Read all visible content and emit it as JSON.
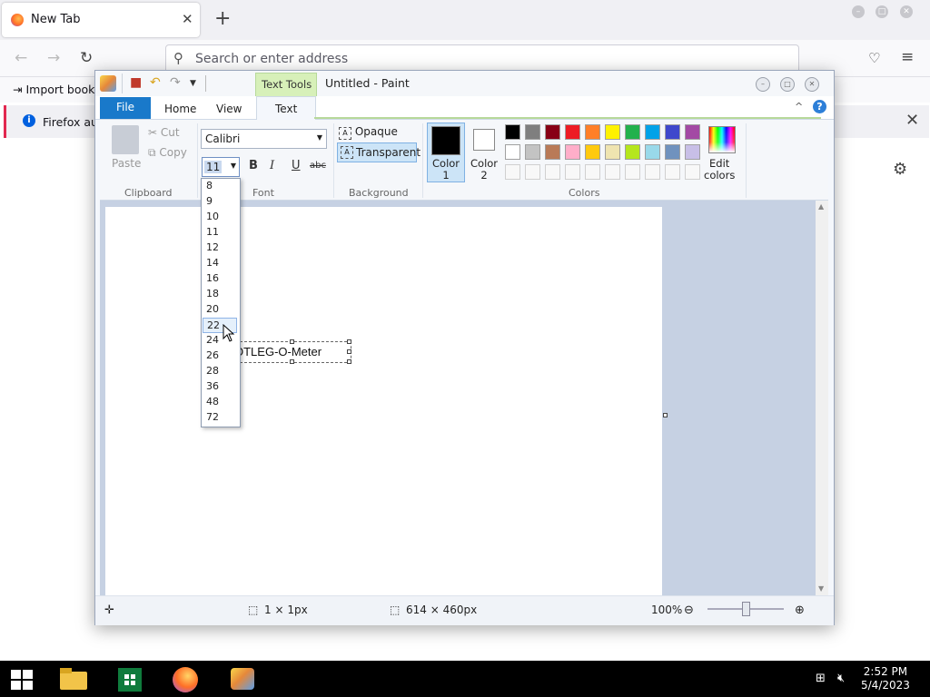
{
  "firefox": {
    "tab_title": "New Tab",
    "tab_close": "✕",
    "new_tab": "+",
    "url_placeholder": "Search or enter address",
    "import_bookmarks": "Import bookm",
    "notice_text": "Firefox auto",
    "notice_icon": "i"
  },
  "paint": {
    "title": "Untitled - Paint",
    "contextual_tab": "Text Tools",
    "tabs": {
      "file": "File",
      "home": "Home",
      "view": "View",
      "text": "Text"
    },
    "help": "?",
    "clipboard": {
      "paste": "Paste",
      "cut": "Cut",
      "copy": "Copy",
      "group": "Clipboard"
    },
    "font": {
      "name": "Calibri",
      "size": "11",
      "bold": "B",
      "italic": "I",
      "underline": "U",
      "strike": "abc",
      "group": "Font"
    },
    "background": {
      "opaque": "Opaque",
      "transparent": "Transparent",
      "group": "Background"
    },
    "colors": {
      "color1": "Color\n1",
      "color2": "Color\n2",
      "edit": "Edit\ncolors",
      "group": "Colors",
      "palette_row1": [
        "#000000",
        "#7f7f7f",
        "#880015",
        "#ed1c24",
        "#ff7f27",
        "#fff200",
        "#22b14c",
        "#00a2e8",
        "#3f48cc",
        "#a349a4"
      ],
      "palette_row2": [
        "#ffffff",
        "#c3c3c3",
        "#b97a57",
        "#ffaec9",
        "#ffc90e",
        "#efe4b0",
        "#b5e61d",
        "#99d9ea",
        "#7092be",
        "#c8bfe7"
      ]
    },
    "canvas_text": "OTLEG-O-Meter",
    "status": {
      "selection": "1 × 1px",
      "canvas_size": "614 × 460px",
      "zoom": "100%"
    },
    "font_sizes": [
      "8",
      "9",
      "10",
      "11",
      "12",
      "14",
      "16",
      "18",
      "20",
      "22",
      "24",
      "26",
      "28",
      "36",
      "48",
      "72"
    ],
    "highlighted_size": "22"
  },
  "taskbar": {
    "time": "2:52 PM",
    "date": "5/4/2023"
  }
}
